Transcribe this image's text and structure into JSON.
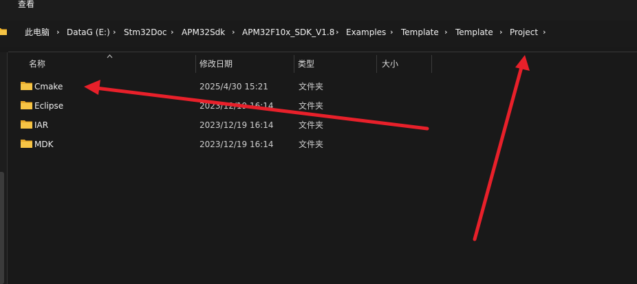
{
  "menubar": {
    "view_label": "查看"
  },
  "breadcrumb": {
    "items": [
      "此电脑",
      "DataG (E:)",
      "Stm32Doc",
      "APM32Sdk",
      "APM32F10x_SDK_V1.8",
      "Examples",
      "Template",
      "Template",
      "Project"
    ],
    "separator": "›"
  },
  "columns": {
    "name": "名称",
    "modified": "修改日期",
    "type": "类型",
    "size": "大小"
  },
  "rows": [
    {
      "name": "Cmake",
      "modified": "2025/4/30 15:21",
      "type": "文件夹",
      "size": ""
    },
    {
      "name": "Eclipse",
      "modified": "2023/12/19 16:14",
      "type": "文件夹",
      "size": ""
    },
    {
      "name": "IAR",
      "modified": "2023/12/19 16:14",
      "type": "文件夹",
      "size": ""
    },
    {
      "name": "MDK",
      "modified": "2023/12/19 16:14",
      "type": "文件夹",
      "size": ""
    }
  ],
  "icons": {
    "folder": "folder-icon",
    "sort": "chevron-up-icon",
    "separator": "chevron-right-icon"
  },
  "colors": {
    "background": "#191919",
    "folder_yellow": "#f6c445",
    "annotation_red": "#e8202a"
  }
}
